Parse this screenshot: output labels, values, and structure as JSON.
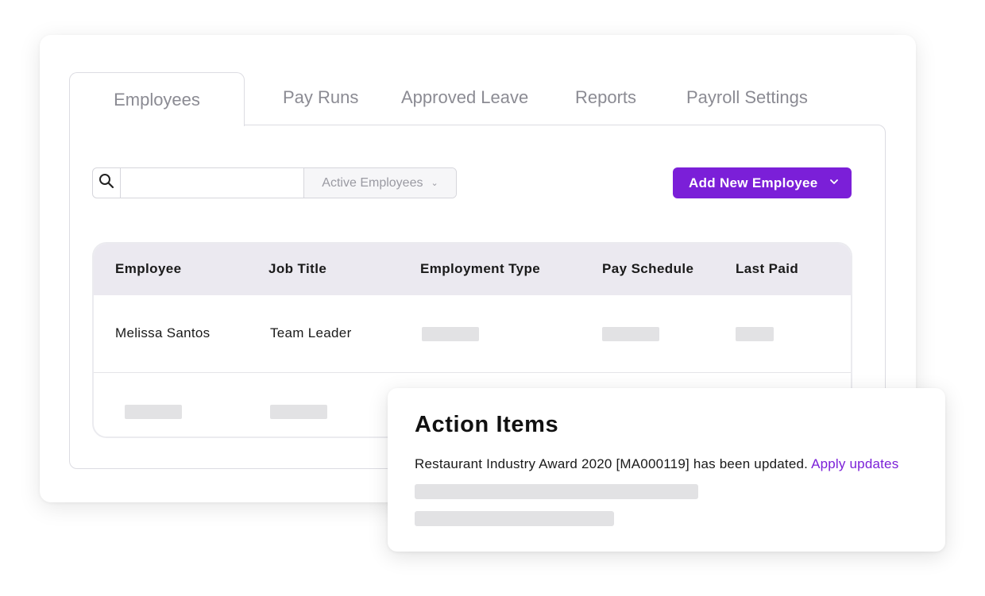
{
  "tabs": {
    "employees": "Employees",
    "pay_runs": "Pay Runs",
    "approved_leave": "Approved Leave",
    "reports": "Reports",
    "payroll_settings": "Payroll Settings"
  },
  "toolbar": {
    "search_value": "",
    "search_placeholder": "",
    "filter_selected": "Active Employees",
    "add_button_label": "Add New Employee",
    "accent_color": "#7b1fd8"
  },
  "table": {
    "columns": [
      "Employee",
      "Job Title",
      "Employment Type",
      "Pay Schedule",
      "Last Paid"
    ],
    "rows": [
      {
        "employee": "Melissa Santos",
        "job_title": "Team Leader"
      }
    ]
  },
  "action_items": {
    "title": "Action Items",
    "message": "Restaurant Industry Award 2020 [MA000119] has been updated.",
    "link_label": "Apply updates"
  },
  "icons": {
    "search": "search-icon",
    "filter_chevron": "chevron-down-icon",
    "add_chevron": "chevron-down-icon"
  }
}
